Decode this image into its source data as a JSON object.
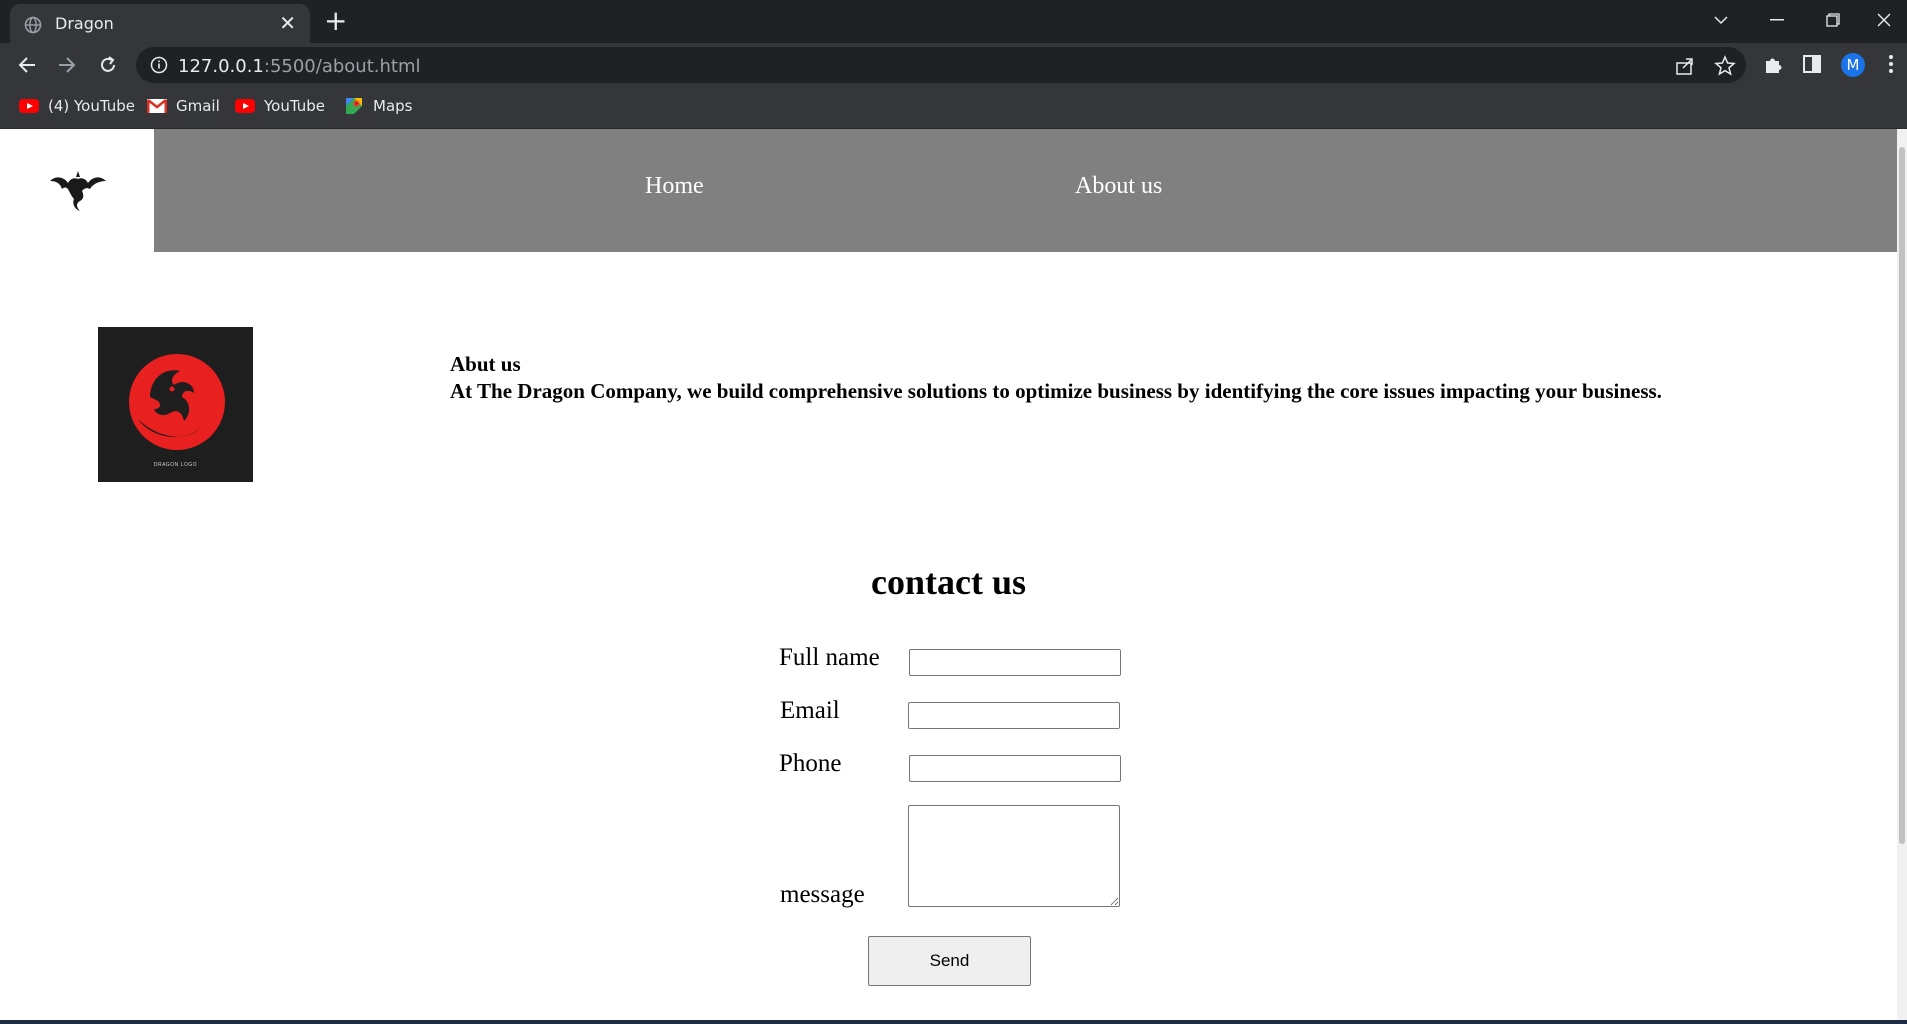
{
  "browser": {
    "tab_title": "Dragon",
    "url_host": "127.0.0.1",
    "url_path": ":5500/about.html",
    "profile_initial": "M",
    "bookmarks": [
      {
        "label": "(4) YouTube",
        "icon": "youtube-icon"
      },
      {
        "label": "Gmail",
        "icon": "gmail-icon"
      },
      {
        "label": "YouTube",
        "icon": "youtube-icon"
      },
      {
        "label": "Maps",
        "icon": "maps-icon"
      }
    ]
  },
  "site": {
    "nav": {
      "home": "Home",
      "about": "About us"
    },
    "about": {
      "heading": "Abut us",
      "body": "At The Dragon Company, we build comprehensive solutions to optimize business by identifying the core issues impacting your business.",
      "logo_caption": "DRAGON LOGO"
    },
    "contact": {
      "title": "contact us",
      "fullname_label": "Full name",
      "email_label": "Email",
      "phone_label": "Phone",
      "message_label": "message",
      "send_label": "Send"
    }
  },
  "colors": {
    "navbar": "#808080",
    "logo_red": "#e8201f",
    "logo_bg": "#1e1e1e"
  }
}
